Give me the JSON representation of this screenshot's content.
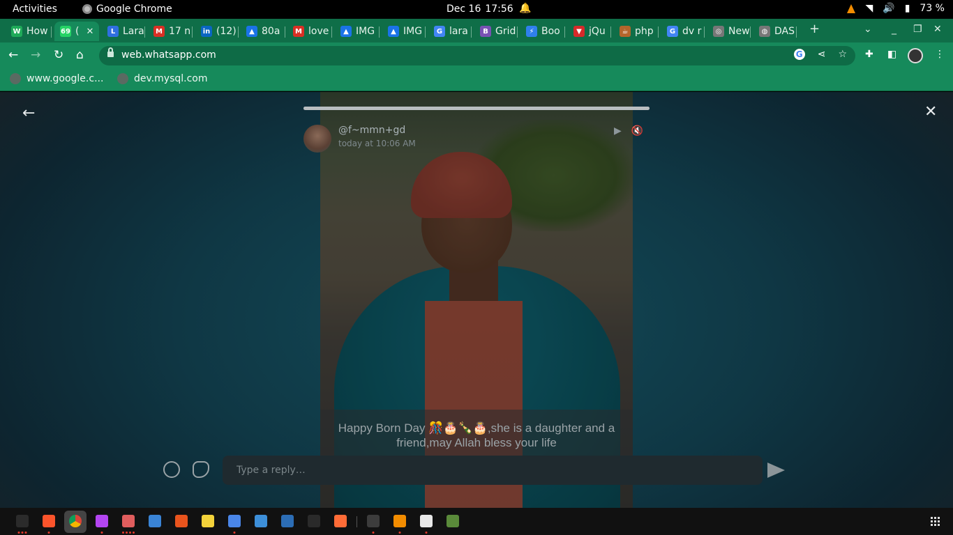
{
  "system_bar": {
    "activities": "Activities",
    "app_name": "Google Chrome",
    "date": "Dec 16",
    "time": "17:56",
    "battery": "73 %"
  },
  "tabs": [
    {
      "label": "How",
      "favicon": "W",
      "color": "#1faa59"
    },
    {
      "label": "(",
      "favicon": "69",
      "color": "#25d366",
      "active": true
    },
    {
      "label": "Lara",
      "favicon": "L",
      "color": "#2f6fe0"
    },
    {
      "label": "17 n",
      "favicon": "M",
      "color": "#d93025"
    },
    {
      "label": "(12)",
      "favicon": "in",
      "color": "#0a66c2"
    },
    {
      "label": "80a",
      "favicon": "▲",
      "color": "#1a73e8"
    },
    {
      "label": "love",
      "favicon": "M",
      "color": "#d93025"
    },
    {
      "label": "IMG",
      "favicon": "▲",
      "color": "#1a73e8"
    },
    {
      "label": "IMG",
      "favicon": "▲",
      "color": "#1a73e8"
    },
    {
      "label": "lara",
      "favicon": "G",
      "color": "#4285f4"
    },
    {
      "label": "Grid",
      "favicon": "B",
      "color": "#7952b3"
    },
    {
      "label": "Boo",
      "favicon": "⚡",
      "color": "#2f80ed"
    },
    {
      "label": "jQu",
      "favicon": "▼",
      "color": "#d62a2a"
    },
    {
      "label": "php",
      "favicon": "☕",
      "color": "#b4652b"
    },
    {
      "label": "dv r",
      "favicon": "G",
      "color": "#4285f4"
    },
    {
      "label": "New",
      "favicon": "◎",
      "color": "#777777"
    },
    {
      "label": "DAS",
      "favicon": "◍",
      "color": "#777777"
    }
  ],
  "address_bar": {
    "url": "web.whatsapp.com"
  },
  "bookmarks": [
    {
      "label": "www.google.c..."
    },
    {
      "label": "dev.mysql.com"
    }
  ],
  "status": {
    "poster_name": "@f~mmn+gd",
    "posted_time": "today at 10:06 AM",
    "progress": 1.0,
    "caption": "Happy Born Day 🎊🎂🍾🎂,she is a daughter and a friend,may Allah bless your life",
    "reply_placeholder": "Type a reply…"
  },
  "icons": {
    "back": "←",
    "close": "✕",
    "play": "▶",
    "mute": "🔇",
    "new_tab": "+",
    "tab_search": "⌄",
    "minimize": "_",
    "restore": "❐",
    "window_close": "✕"
  },
  "dock": [
    {
      "name": "terminal",
      "color": "#2b2b2b",
      "running": 3
    },
    {
      "name": "brave",
      "color": "#fb542b",
      "running": 1
    },
    {
      "name": "phpstorm",
      "color": "#b345f1",
      "running": 1
    },
    {
      "name": "files",
      "color": "#e05d5d",
      "running": 4
    },
    {
      "name": "thunderbird",
      "color": "#3a84d6",
      "running": 0
    },
    {
      "name": "app-center",
      "color": "#e9541d",
      "running": 0
    },
    {
      "name": "rhythmbox",
      "color": "#f3d23a",
      "running": 0
    },
    {
      "name": "text-editor",
      "color": "#4a86e8",
      "running": 1
    },
    {
      "name": "help",
      "color": "#3d8fd9",
      "running": 0
    },
    {
      "name": "vscode",
      "color": "#2c6db5",
      "running": 0
    },
    {
      "name": "whatsapp",
      "color": "#2a2a2a",
      "running": 0
    },
    {
      "name": "postman",
      "color": "#ff6c37",
      "running": 0
    },
    {
      "name": "system-monitor",
      "color": "#3c3c3c",
      "running": 1
    },
    {
      "name": "vlc",
      "color": "#f28c00",
      "running": 1
    },
    {
      "name": "notes",
      "color": "#e8e8e8",
      "running": 1
    },
    {
      "name": "trash",
      "color": "#5a8a3a",
      "running": 0
    }
  ]
}
